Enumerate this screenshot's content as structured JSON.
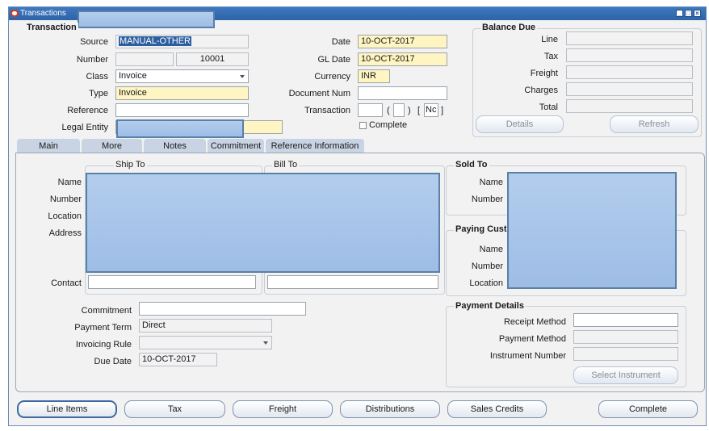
{
  "window": {
    "title": "Transactions"
  },
  "header": {
    "section_title": "Transaction",
    "source_label": "Source",
    "source_value": "MANUAL-OTHER",
    "number_label": "Number",
    "number_value": "10001",
    "class_label": "Class",
    "class_value": "Invoice",
    "type_label": "Type",
    "type_value": "Invoice",
    "reference_label": "Reference",
    "reference_value": "",
    "legal_entity_label": "Legal Entity",
    "date_label": "Date",
    "date_value": "10-OCT-2017",
    "gl_date_label": "GL Date",
    "gl_date_value": "10-OCT-2017",
    "currency_label": "Currency",
    "currency_value": "INR",
    "document_num_label": "Document Num",
    "document_num_value": "",
    "transaction_label": "Transaction",
    "transaction_open_paren": "(",
    "transaction_close_paren": ")",
    "transaction_open_bracket": "[",
    "transaction_code": "Nc",
    "transaction_close_bracket": "]",
    "complete_label": "Complete"
  },
  "balance_due": {
    "title": "Balance Due",
    "line_label": "Line",
    "tax_label": "Tax",
    "freight_label": "Freight",
    "charges_label": "Charges",
    "total_label": "Total",
    "details_button": "Details",
    "refresh_button": "Refresh"
  },
  "tabs": [
    {
      "label": "Main",
      "state": "active"
    },
    {
      "label": "More",
      "state": "normal"
    },
    {
      "label": "Notes",
      "state": "normal"
    },
    {
      "label": "Commitment",
      "state": "disabled"
    },
    {
      "label": "Reference Information",
      "state": "disabled"
    }
  ],
  "main": {
    "ship_to_title": "Ship To",
    "bill_to_title": "Bill To",
    "name_label": "Name",
    "number_label": "Number",
    "location_label": "Location",
    "address_label": "Address",
    "contact_label": "Contact",
    "sold_to_title": "Sold To",
    "sold_name_label": "Name",
    "sold_number_label": "Number",
    "paying_title": "Paying Cust",
    "paying_name_label": "Name",
    "paying_number_label": "Number",
    "paying_location_label": "Location",
    "commitment_label": "Commitment",
    "commitment_value": "",
    "payment_term_label": "Payment Term",
    "payment_term_value": "Direct",
    "invoicing_rule_label": "Invoicing Rule",
    "invoicing_rule_value": "",
    "due_date_label": "Due Date",
    "due_date_value": "10-OCT-2017",
    "payment_details_title": "Payment Details",
    "receipt_method_label": "Receipt Method",
    "payment_method_label": "Payment Method",
    "instrument_number_label": "Instrument Number",
    "select_instrument_button": "Select Instrument"
  },
  "footer_buttons": {
    "line_items": "Line Items",
    "tax": "Tax",
    "freight": "Freight",
    "distributions": "Distributions",
    "sales_credits": "Sales Credits",
    "complete": "Complete"
  },
  "colors": {
    "titlebar": "#2e64a8",
    "required_field": "#fff5c2",
    "redaction": "#a9c5ea",
    "tab_active": "#a9c0dc"
  }
}
